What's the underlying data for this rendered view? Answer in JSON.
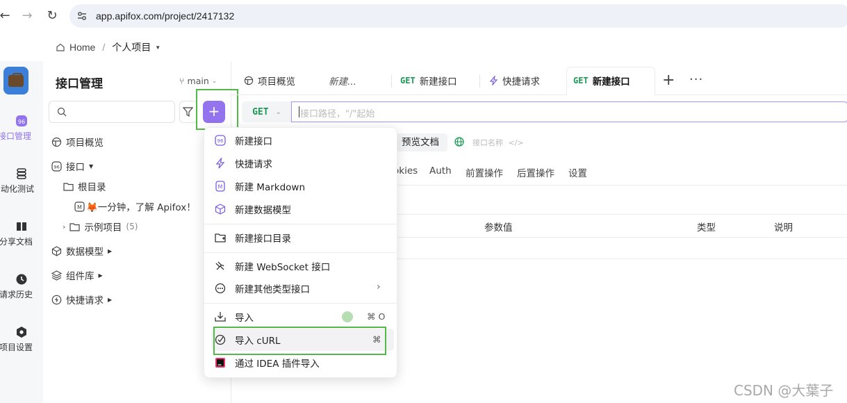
{
  "browser": {
    "url": "app.apifox.com/project/2417132"
  },
  "breadcrumb": {
    "home": "Home",
    "separator": "/",
    "project": "个人项目"
  },
  "rail": [
    {
      "label": "接口管理",
      "icon": "api-management-icon"
    },
    {
      "label": "自动化测试",
      "icon": "automation-test-icon"
    },
    {
      "label": "分享文档",
      "icon": "share-docs-icon"
    },
    {
      "label": "请求历史",
      "icon": "history-icon"
    },
    {
      "label": "项目设置",
      "icon": "settings-icon"
    }
  ],
  "panel": {
    "title": "接口管理",
    "branch": "main",
    "tree": {
      "overview": "项目概览",
      "api": "接口",
      "root_dir": "根目录",
      "doc": "🦊一分钟，了解 Apifox！",
      "examples": "示例项目",
      "examples_count": "(5)",
      "data_models": "数据模型",
      "components": "组件库",
      "quick_requests": "快捷请求"
    }
  },
  "tabs": [
    {
      "label": "项目概览"
    },
    {
      "label": "新建..."
    },
    {
      "method": "GET",
      "label": "新建接口"
    },
    {
      "label": "快捷请求"
    },
    {
      "method": "GET",
      "label": "新建接口"
    }
  ],
  "request": {
    "method": "GET",
    "path_placeholder": "接口路径，\"/\"起始"
  },
  "content": {
    "preview_doc": "预览文档",
    "api_name_placeholder": "接口名称",
    "subtabs": [
      "okies",
      "Auth",
      "前置操作",
      "后置操作",
      "设置"
    ],
    "table_headers": [
      "参数值",
      "类型",
      "说明"
    ]
  },
  "menu": {
    "items": [
      {
        "label": "新建接口",
        "icon": "api-icon"
      },
      {
        "label": "快捷请求",
        "icon": "lightning-icon"
      },
      {
        "label": "新建 Markdown",
        "icon": "markdown-icon"
      },
      {
        "label": "新建数据模型",
        "icon": "cube-icon"
      },
      {
        "label": "新建接口目录",
        "icon": "folder-icon"
      },
      {
        "label": "新建 WebSocket 接口",
        "icon": "websocket-icon"
      },
      {
        "label": "新建其他类型接口",
        "icon": "more-circle-icon"
      },
      {
        "label": "导入",
        "icon": "import-icon",
        "shortcut": "⌘ O"
      },
      {
        "label": "导入 cURL",
        "icon": "curl-icon",
        "shortcut": "⌘"
      },
      {
        "label": "通过 IDEA 插件导入",
        "icon": "idea-icon"
      }
    ]
  },
  "watermark": "CSDN @大葉子",
  "colors": {
    "accent": "#9373ee",
    "get_method": "#1a9a55",
    "highlight_box": "#52b947"
  }
}
